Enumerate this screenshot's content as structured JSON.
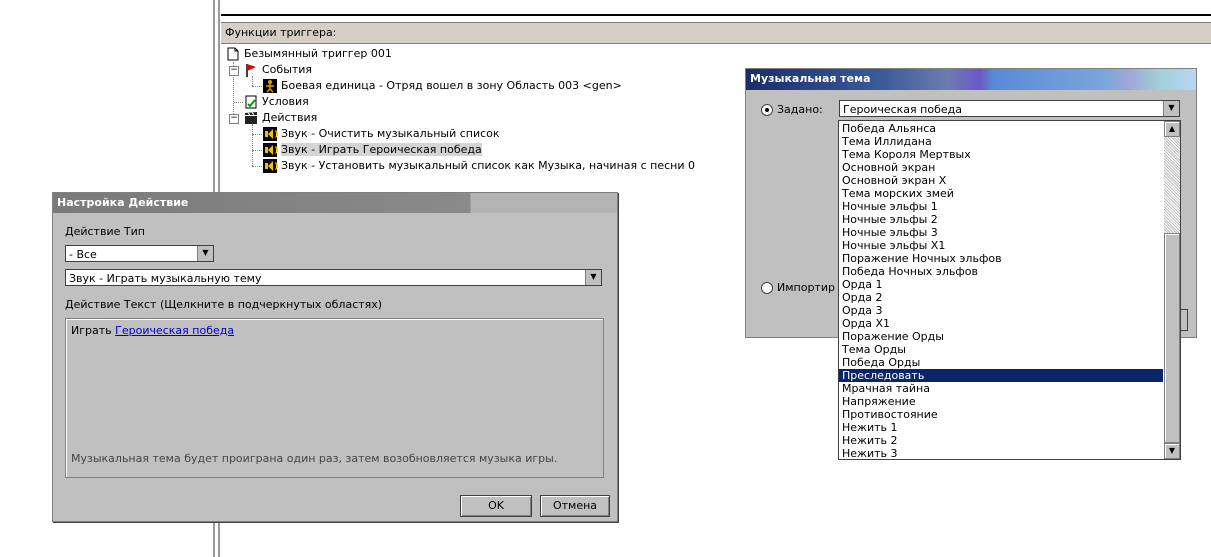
{
  "panel": {
    "header": "Функции триггера:"
  },
  "tree": {
    "root": "Безымянный триггер 001",
    "events_label": "События",
    "event_item": "Боевая единица - Отряд вошел в зону Область 003 <gen>",
    "conditions_label": "Условия",
    "actions_label": "Действия",
    "action_items": [
      "Звук - Очистить музыкальный список",
      "Звук - Играть Героическая победа",
      "Звук - Установить музыкальный список как Музыка, начиная с песни 0"
    ],
    "selected_index": 1
  },
  "action_dialog": {
    "title": "Настройка Действие",
    "type_label": "Действие Тип",
    "type_value": "- Все",
    "action_value": "Звук - Играть музыкальную тему",
    "text_label": "Действие Текст (Щелкните в подчеркнутых областях)",
    "text_prefix": "Играть",
    "text_link": "Героическая победа",
    "hint": "Музыкальная тема будет проиграна один раз, затем возобновляется музыка игры.",
    "ok": "OK",
    "cancel": "Отмена"
  },
  "music_dialog": {
    "title": "Музыкальная тема",
    "radio_preset": "Задано:",
    "radio_import": "Импортир",
    "selected_value": "Героическая победа",
    "options": [
      "Победа Альянса",
      "Тема Иллидана",
      "Тема Короля Мертвых",
      "Основной экран",
      "Основной экран X",
      "Тема морских змей",
      "Ночные эльфы 1",
      "Ночные эльфы 2",
      "Ночные эльфы 3",
      "Ночные эльфы X1",
      "Поражение Ночных эльфов",
      "Победа Ночных эльфов",
      "Орда 1",
      "Орда 2",
      "Орда 3",
      "Орда X1",
      "Поражение Орды",
      "Тема Орды",
      "Победа Орды",
      "Преследовать",
      "Мрачная тайна",
      "Напряжение",
      "Противостояние",
      "Нежить 1",
      "Нежить 2",
      "Нежить 3"
    ],
    "highlighted_index": 19
  },
  "colors": {
    "selection": "#0a246a",
    "link": "#0000cc",
    "dialog_bg": "#c0c0c0"
  }
}
